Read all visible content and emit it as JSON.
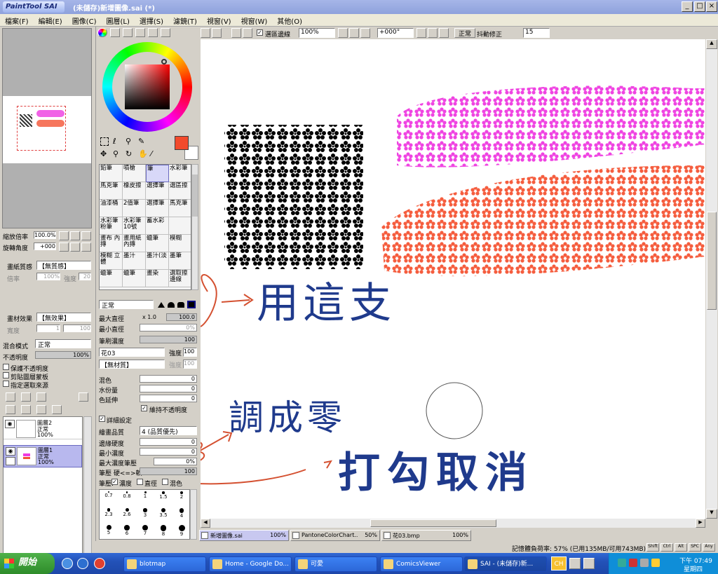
{
  "window": {
    "app_logo": "PaintTool SAI",
    "title": "(未儲存)新增圖像.sai (*)",
    "buttons": [
      "_",
      "□",
      "×"
    ]
  },
  "menu": [
    "檔案(F)",
    "編輯(E)",
    "圖像(C)",
    "圖層(L)",
    "選擇(S)",
    "濾鏡(T)",
    "視窗(V)",
    "視窗(W)",
    "其他(O)"
  ],
  "nav": {
    "zoom_label": "縮放倍率",
    "zoom_value": "100.0%",
    "rotate_label": "旋轉角度",
    "rotate_value": "+000"
  },
  "paper": {
    "texture_label": "畫紙質感",
    "texture_value": "【無質感】",
    "scale_label": "倍率",
    "scale_value": "100%",
    "strength_label": "強度",
    "strength_value": "20",
    "effect_label": "畫材效果",
    "effect_value": "【無效果】",
    "width_label": "寬度",
    "width_value": "1",
    "strength2_value": "100"
  },
  "layer_props": {
    "blend_label": "混合模式",
    "blend_value": "正常",
    "opacity_label": "不透明度",
    "opacity_value": "100%",
    "checks": [
      "保護不透明度",
      "剪貼圖層蒙板",
      "指定選取來源"
    ]
  },
  "layers": [
    {
      "name": "圖層2",
      "mode": "正常",
      "opacity": "100%",
      "selected": false
    },
    {
      "name": "圖層1",
      "mode": "正常",
      "opacity": "100%",
      "selected": true
    }
  ],
  "brush_tools": [
    "鉛筆",
    "噴槍",
    "筆",
    "水彩筆",
    "馬克筆",
    "橡皮擦",
    "選擇筆",
    "選區擦",
    "油漆桶",
    "2值筆",
    "選擇筆",
    "馬克筆",
    "水彩筆 粉筆",
    "水彩筆 10號",
    "蓄水彩",
    "",
    "畫布 內摶",
    "畫用紙 內摶",
    "蠟筆",
    "模糊",
    "模糊 立體",
    "墨汁",
    "墨汁(淡",
    "墨筆",
    "蠟筆",
    "蠟筆",
    "畫染",
    "選取擦 邊線"
  ],
  "brush": {
    "mode": "正常",
    "max_size_label": "最大直徑",
    "max_size_mult": "x 1.0",
    "max_size_value": "100.0",
    "min_size_label": "最小直徑",
    "min_size_value": "0%",
    "density_label": "筆刷濃度",
    "density_value": "100",
    "shape": "花03",
    "shape_strength_label": "強度",
    "shape_strength": "100",
    "texture": "【無材質】",
    "texture_strength": "100",
    "blend_label": "混色",
    "blend_value": "0",
    "water_label": "水份量",
    "water_value": "0",
    "extend_label": "色延伸",
    "extend_value": "0",
    "keep_opacity": "維持不透明度",
    "detail_label": "詳細設定",
    "quality_label": "繪畫品質",
    "quality_value": "4 (品質優先)",
    "edge_label": "邊緣硬度",
    "edge_value": "0",
    "min_density_label": "最小濃度",
    "min_density_value": "0",
    "max_density_label": "最大濃度筆壓",
    "max_density_value": "0%",
    "pressure_label": "筆壓 硬<=>軟",
    "pressure_value": "100",
    "pressure_opts_label": "筆壓:",
    "opt_density": "濃度",
    "opt_size": "直徑",
    "opt_blend": "混色",
    "sizes": [
      "0.7",
      "0.8",
      "1",
      "1.5",
      "2",
      "2.3",
      "2.6",
      "3",
      "3.5",
      "4",
      "5",
      "6",
      "7",
      "8",
      "9"
    ]
  },
  "canvas_toolbar": {
    "select_edge": "選區邊線",
    "zoom": "100%",
    "angle": "+000°",
    "mode": "正常",
    "stabilizer_label": "抖動修正",
    "stabilizer": "15"
  },
  "annotations": {
    "use_this": "用這支",
    "set_to_zero": "調成零",
    "uncheck": "打勾取消"
  },
  "doc_tabs": [
    {
      "name": "新增圖像.sai",
      "zoom": "100%"
    },
    {
      "name": "PantoneColorChart...",
      "zoom": "50%"
    },
    {
      "name": "花03.bmp",
      "zoom": "100%"
    }
  ],
  "status": {
    "memory": "記憶體負荷率: 57% (已用135MB/可用743MB)",
    "keys": [
      "Shift",
      "Ctrl",
      "Alt",
      "SPC",
      "Any"
    ]
  },
  "taskbar": {
    "start": "開始",
    "items": [
      "blotmap",
      "Home - Google Do...",
      "可愛",
      "ComicsViewer",
      "SAI - (未儲存)新..."
    ],
    "ime": "CH",
    "time": "下午 07:49",
    "day": "星期四"
  },
  "colors": {
    "accent_layer": "#b8b8ee",
    "primary": "#f24a2c",
    "magenta": "#ee3ae0",
    "orange": "#f45434",
    "handwriting": "#1f3a8c",
    "red_ink": "#d45030"
  }
}
